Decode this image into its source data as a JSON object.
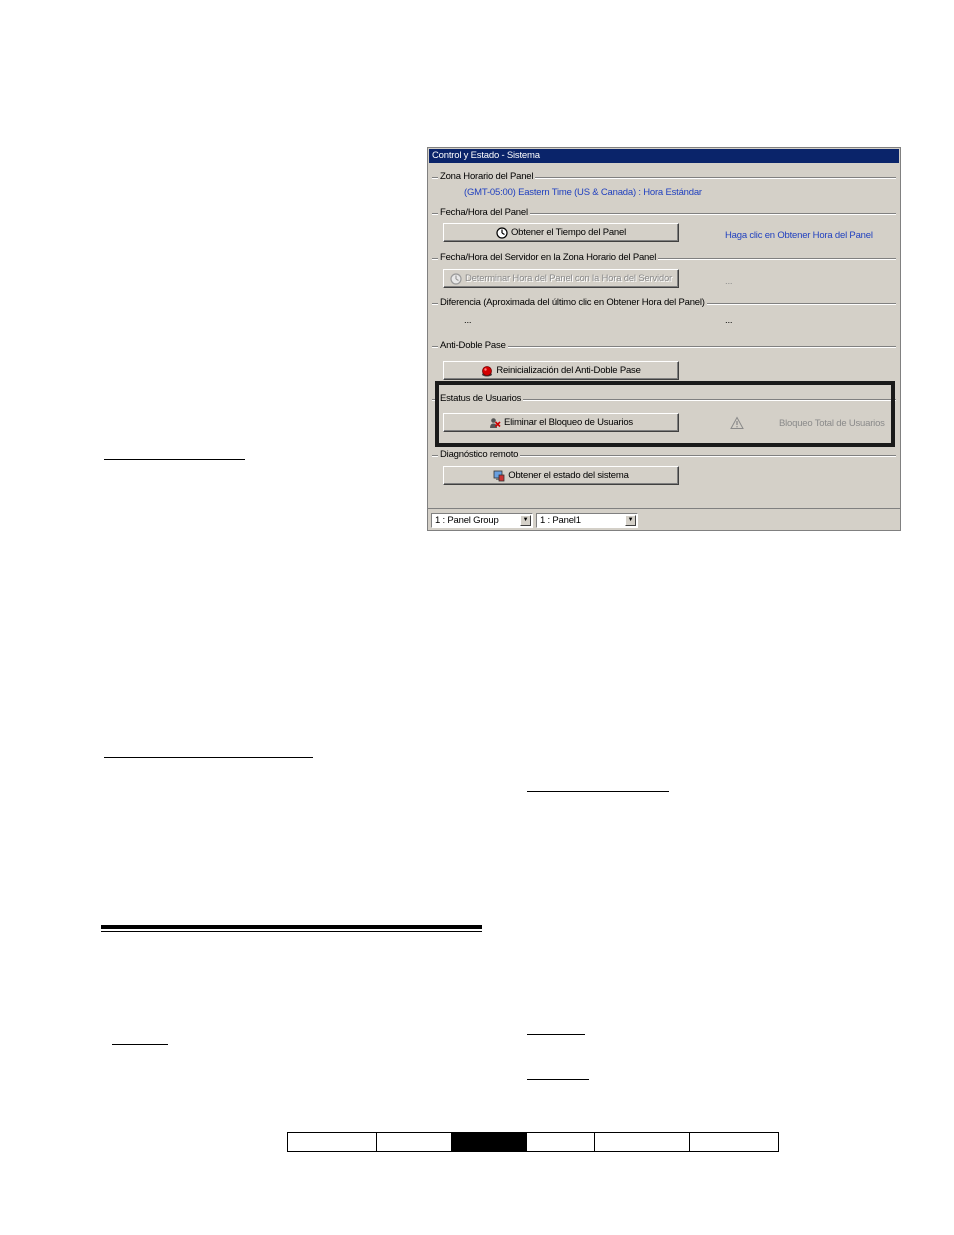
{
  "window": {
    "title": "Control y Estado - Sistema",
    "groups": {
      "timezone": {
        "label": "Zona Horario del Panel",
        "value": "(GMT-05:00) Eastern Time (US & Canada) : Hora Estándar"
      },
      "panel_datetime": {
        "label": "Fecha/Hora del Panel",
        "button": "Obtener el Tiempo del Panel",
        "hint": "Haga clic en Obtener Hora del Panel"
      },
      "server_datetime": {
        "label": "Fecha/Hora del Servidor en la Zona Horario del Panel",
        "button": "Determinar Hora del Panel con la Hora del Servidor",
        "value": "..."
      },
      "difference": {
        "label": "Diferencia (Aproximada del último clic en Obtener Hora del Panel)",
        "value_left": "...",
        "value_right": "..."
      },
      "anti_passback": {
        "label": "Anti-Doble Pase",
        "button": "Reinicialización del Anti-Doble Pase"
      },
      "user_status": {
        "label": "Estatus de Usuarios",
        "button": "Eliminar el Bloqueo de Usuarios",
        "status": "Bloqueo Total de Usuarios"
      },
      "remote_diag": {
        "label": "Diagnóstico remoto",
        "button": "Obtener el estado del sistema"
      }
    },
    "statusbar": {
      "group_select": "1 : Panel Group",
      "panel_select": "1 : Panel1"
    }
  },
  "colors": {
    "titlebar": "#0a246a",
    "dialog_bg": "#d4d0c8",
    "link_blue": "#1f3fbf",
    "highlight_border": "#1a1a1a"
  },
  "icons": {
    "panel_time": "clock-icon",
    "server_time": "clock-icon",
    "anti_passback": "red-button-icon",
    "unlock_users": "users-lock-icon",
    "warning": "warning-triangle-icon",
    "system_status": "computer-status-icon",
    "dropdown": "chevron-down-icon"
  }
}
